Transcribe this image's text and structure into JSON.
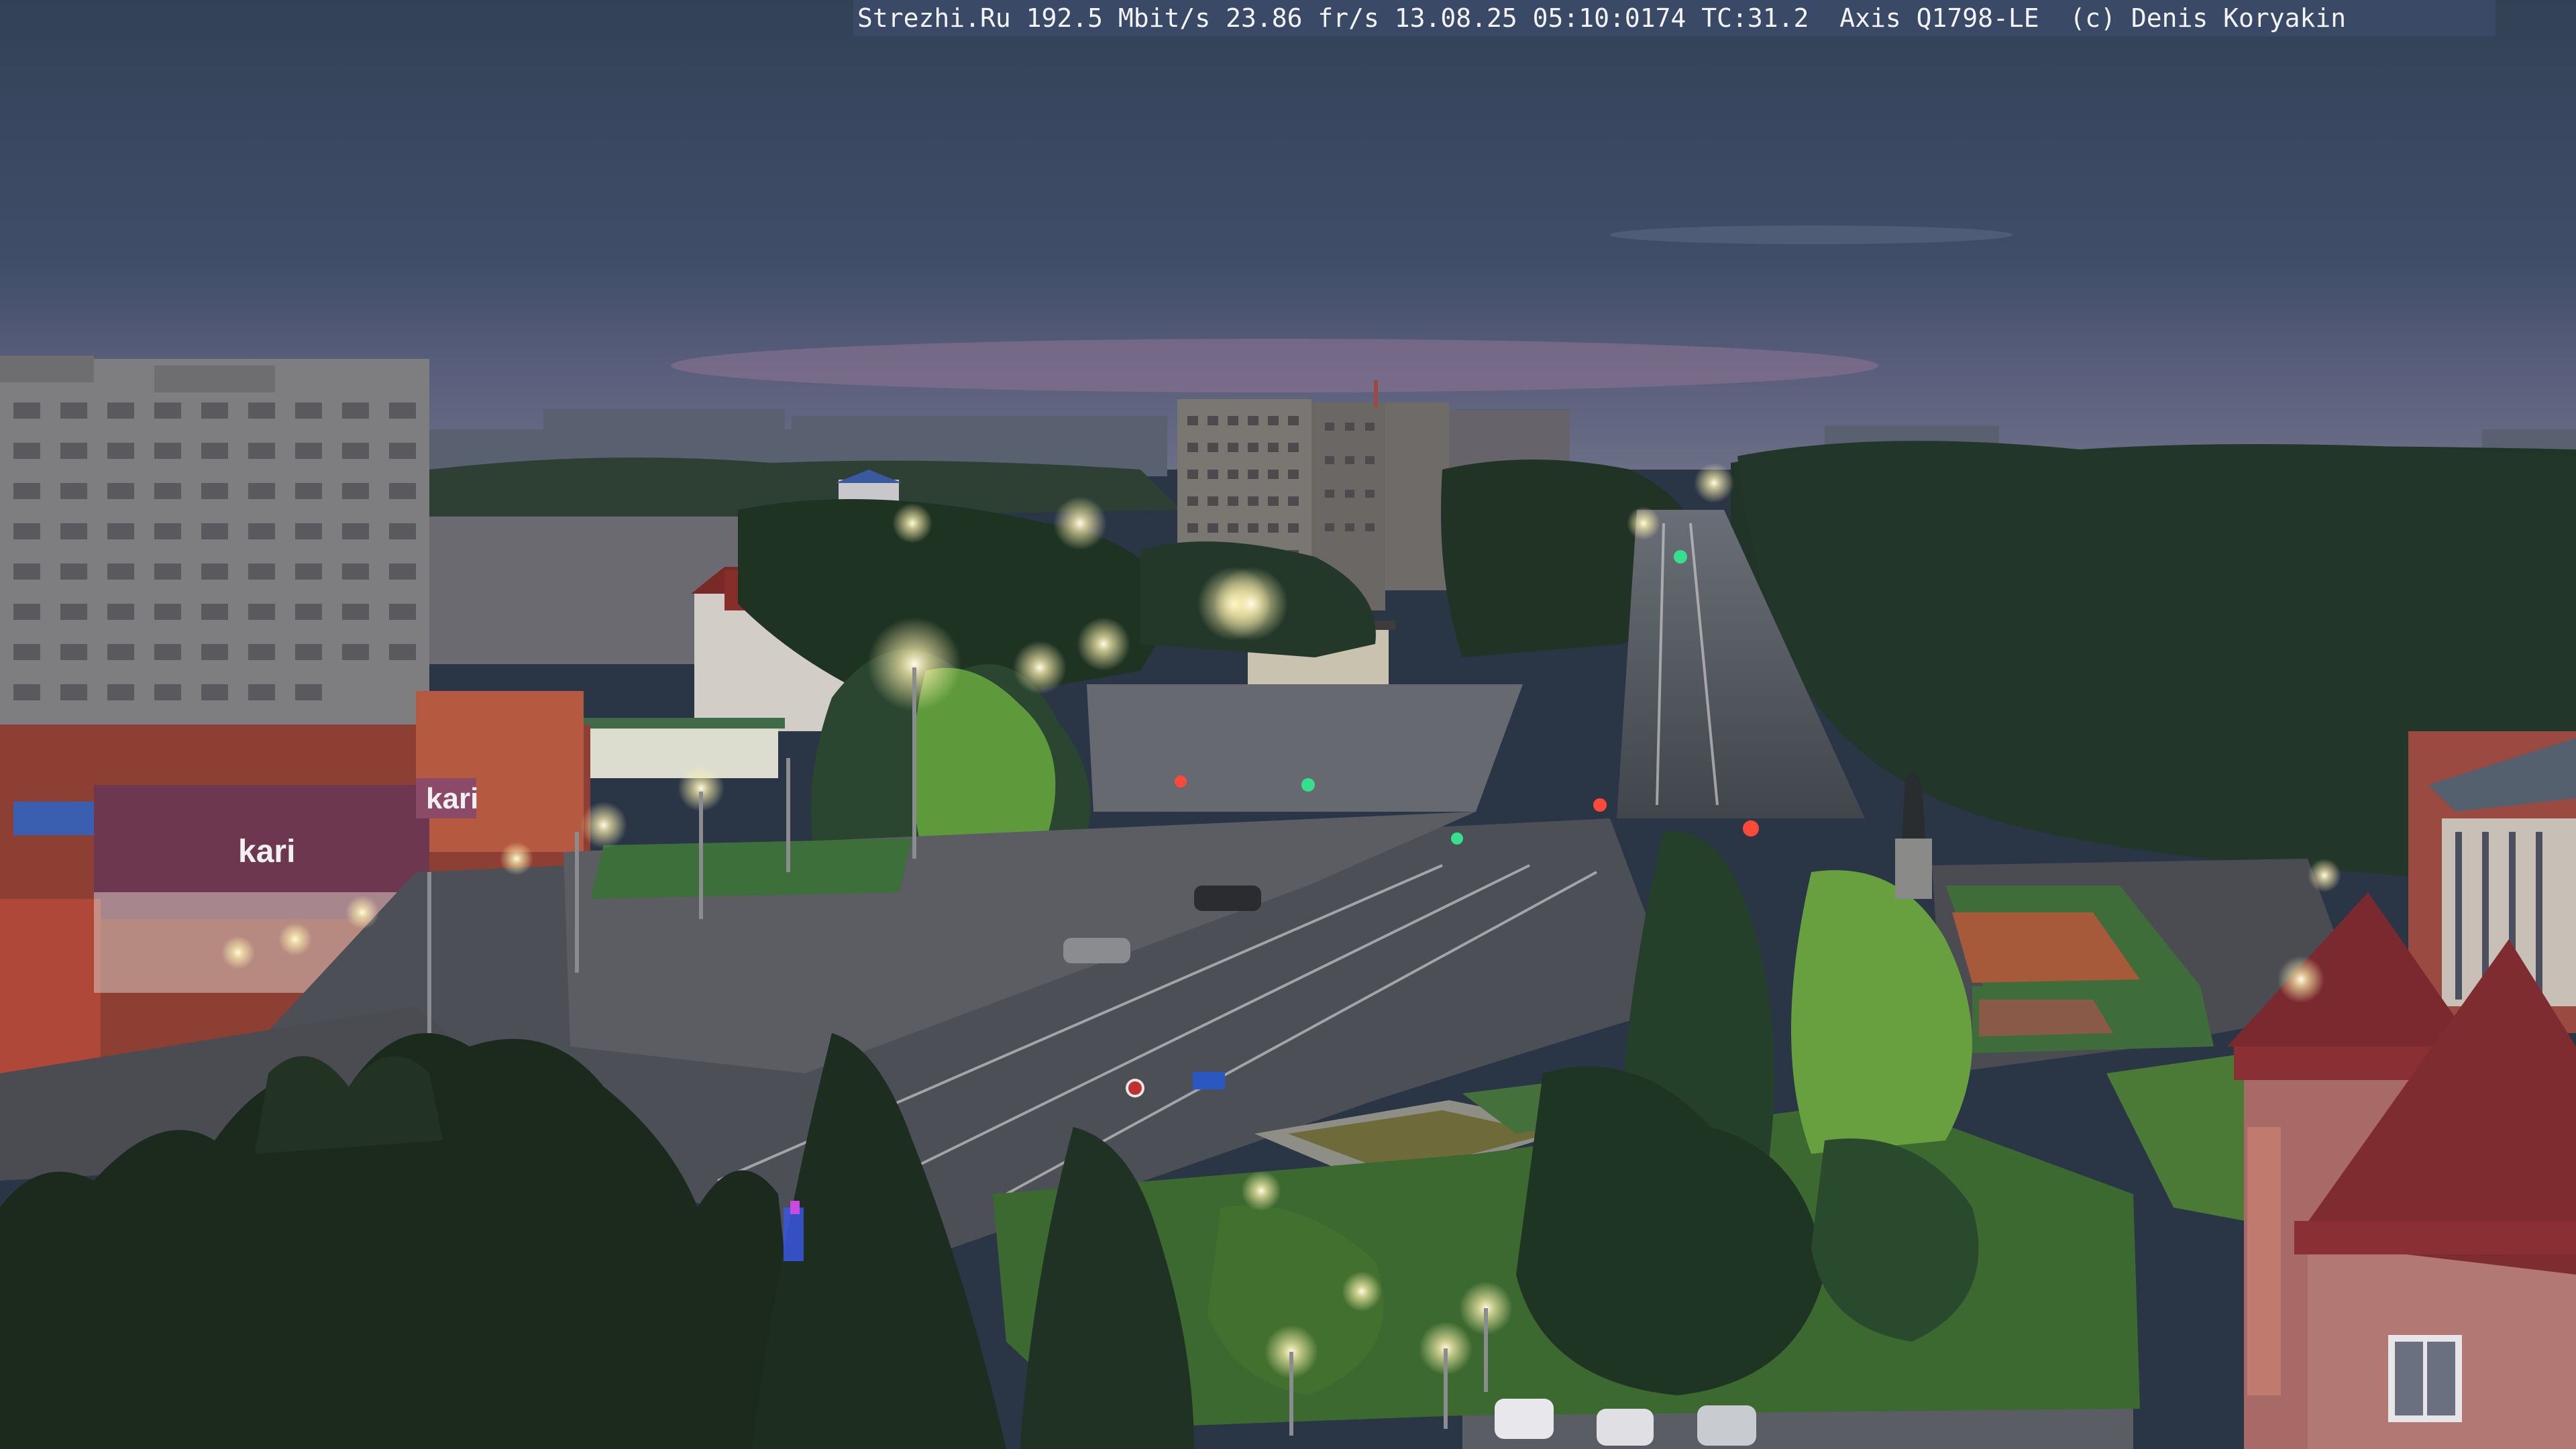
{
  "overlay": {
    "text": "Strezhi.Ru 192.5 Mbit/s 23.86 fr/s 13.08.25 05:10:0174 TC:31.2  Axis Q1798-LE  (c) Denis Koryakin"
  },
  "scene": {
    "signs": {
      "left_store": "kari",
      "right_store": "kari"
    }
  },
  "colors": {
    "sky_top": "#3b4a63",
    "sky_horizon": "#6a6f8a",
    "sunrise_glow": "#9a7a98",
    "trees": "#24382a",
    "trees_lit": "#5f9a3a",
    "road": "#4a4e56",
    "plaza": "#5d6066",
    "grass": "#3f6b34",
    "brick_red": "#8a3b34",
    "lamp": "#fff8d8"
  }
}
